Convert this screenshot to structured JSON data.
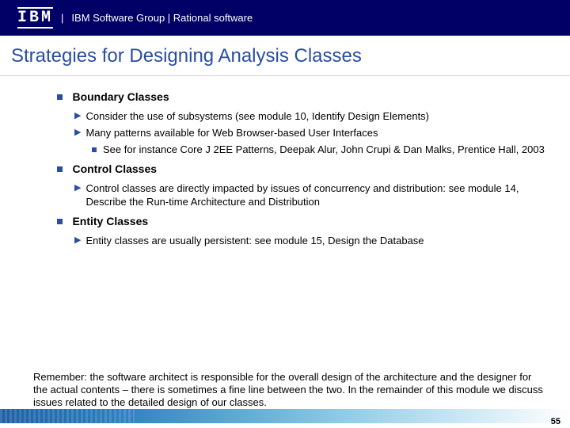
{
  "header": {
    "logo": "IBM",
    "text": "IBM Software Group | Rational software"
  },
  "title": "Strategies for Designing Analysis Classes",
  "sections": [
    {
      "heading": "Boundary Classes",
      "items": [
        {
          "text": "Consider the use of subsystems (see module 10, Identify Design Elements)"
        },
        {
          "text": "Many patterns available for Web Browser-based User Interfaces",
          "sub": [
            "See for instance Core J 2EE Patterns, Deepak Alur, John Crupi & Dan Malks, Prentice Hall, 2003"
          ]
        }
      ]
    },
    {
      "heading": "Control Classes",
      "items": [
        {
          "text": "Control classes are directly impacted by issues of concurrency and distribution: see module 14, Describe the Run-time Architecture and Distribution"
        }
      ]
    },
    {
      "heading": "Entity Classes",
      "items": [
        {
          "text": "Entity classes are usually persistent: see module 15, Design the Database"
        }
      ]
    }
  ],
  "remember": "Remember: the software architect is responsible for the overall design of the architecture and the designer for the actual contents – there is sometimes a fine line between the two. In the remainder of this module we discuss issues related to the detailed design of our classes.",
  "page_number": "55"
}
